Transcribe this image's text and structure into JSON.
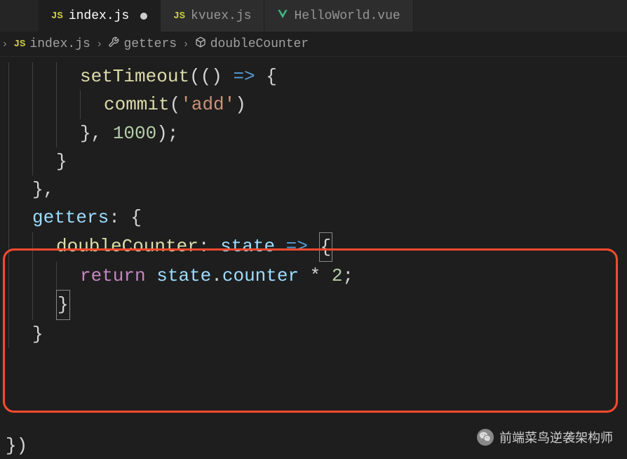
{
  "tabs": [
    {
      "icon": "JS",
      "label": "index.js",
      "active": true,
      "modified": true
    },
    {
      "icon": "JS",
      "label": "kvuex.js",
      "active": false,
      "modified": false
    },
    {
      "icon": "V",
      "label": "HelloWorld.vue",
      "active": false,
      "modified": false
    }
  ],
  "breadcrumb": {
    "parts": [
      {
        "icon": "JS",
        "label": "index.js"
      },
      {
        "icon": "tool",
        "label": "getters"
      },
      {
        "icon": "cube",
        "label": "doubleCounter"
      }
    ]
  },
  "code": {
    "l1_settimeout": "setTimeout",
    "l1_arrow": "=>",
    "l1_open": "(() ",
    "l1_brace": " {",
    "l2_commit": "commit",
    "l2_open": "(",
    "l2_str": "'add'",
    "l2_close": ")",
    "l3_close": "}, ",
    "l3_num": "1000",
    "l3_semi": ");",
    "l4_brace": "}",
    "l5_close": "},",
    "l6_getters": "getters",
    "l6_colon": ": {",
    "l7_dc": "doubleCounter",
    "l7_colon": ": ",
    "l7_state": "state",
    "l7_arrow": " => ",
    "l7_brace": "{",
    "l8_return": "return",
    "l8_sp": " ",
    "l8_state": "state",
    "l8_dot": ".",
    "l8_counter": "counter",
    "l8_mul": " * ",
    "l8_two": "2",
    "l8_semi": ";",
    "l9_brace": "}",
    "l10_brace": "}",
    "l11_brace": "})"
  },
  "watermark": "前端菜鸟逆袭架构师"
}
